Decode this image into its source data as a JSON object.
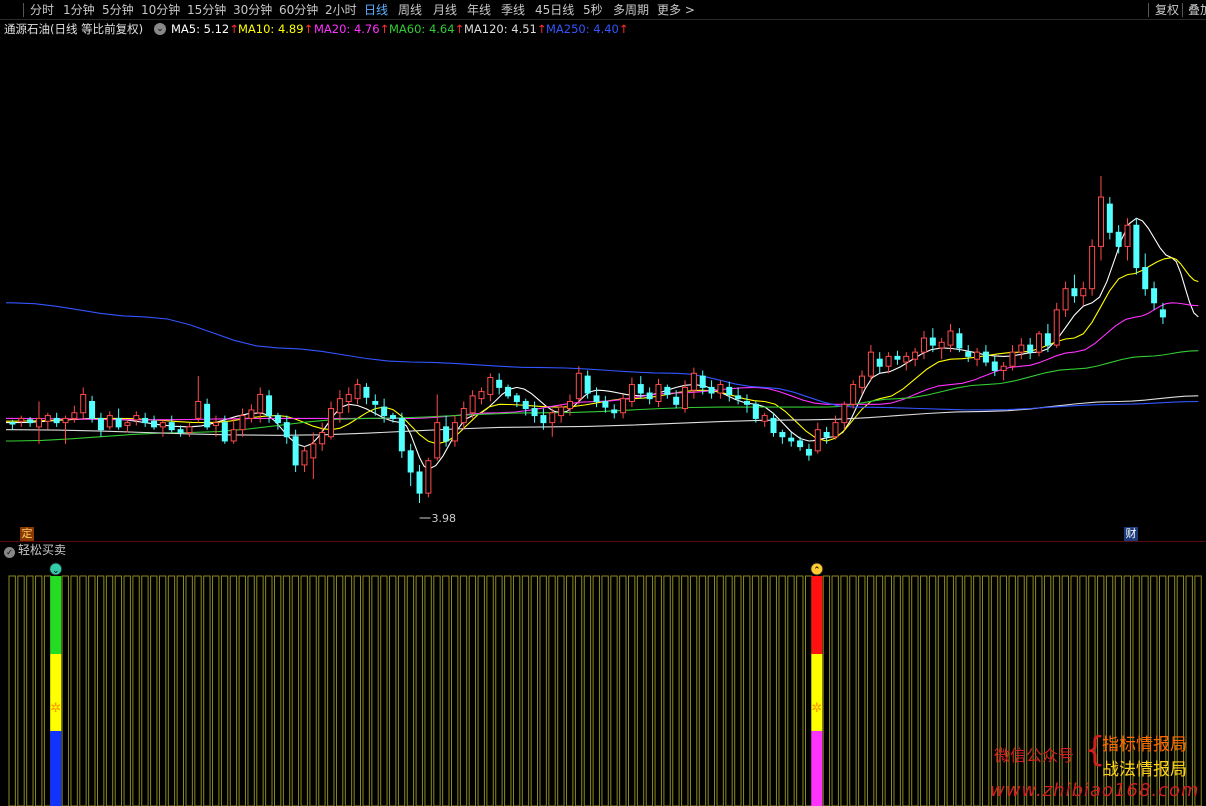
{
  "toolbar": {
    "timeframes": [
      "分时",
      "1分钟",
      "5分钟",
      "10分钟",
      "15分钟",
      "30分钟",
      "60分钟",
      "2小时",
      "日线",
      "周线",
      "月线",
      "年线",
      "季线",
      "45日线",
      "5秒",
      "多周期",
      "更多 >"
    ],
    "active": "日线",
    "right": [
      "复权",
      "叠加"
    ]
  },
  "legend": {
    "title": "通源石油(日线 等比前复权)",
    "ma": [
      {
        "label": "MA5: 5.12",
        "color": "#ffffff"
      },
      {
        "label": "MA10: 4.89",
        "color": "#ffff00"
      },
      {
        "label": "MA20: 4.76",
        "color": "#ff33ff"
      },
      {
        "label": "MA60: 4.64",
        "color": "#33cc33"
      },
      {
        "label": "MA120: 4.51",
        "color": "#dddddd"
      },
      {
        "label": "MA250: 4.40",
        "color": "#3355ff"
      }
    ],
    "arrow": "↑"
  },
  "chart_data": {
    "type": "candlestick",
    "ylim": [
      3.8,
      6.8
    ],
    "candles": [
      [
        4.55,
        4.57,
        4.5,
        4.54
      ],
      [
        4.56,
        4.6,
        4.52,
        4.58
      ],
      [
        4.57,
        4.59,
        4.52,
        4.55
      ],
      [
        4.52,
        4.7,
        4.4,
        4.58
      ],
      [
        4.56,
        4.62,
        4.5,
        4.6
      ],
      [
        4.58,
        4.62,
        4.52,
        4.55
      ],
      [
        4.55,
        4.6,
        4.4,
        4.58
      ],
      [
        4.58,
        4.67,
        4.55,
        4.62
      ],
      [
        4.62,
        4.8,
        4.58,
        4.75
      ],
      [
        4.7,
        4.74,
        4.55,
        4.58
      ],
      [
        4.58,
        4.62,
        4.45,
        4.5
      ],
      [
        4.52,
        4.63,
        4.5,
        4.6
      ],
      [
        4.58,
        4.65,
        4.5,
        4.52
      ],
      [
        4.53,
        4.57,
        4.48,
        4.55
      ],
      [
        4.57,
        4.63,
        4.53,
        4.6
      ],
      [
        4.58,
        4.62,
        4.52,
        4.55
      ],
      [
        4.56,
        4.6,
        4.5,
        4.52
      ],
      [
        4.52,
        4.57,
        4.45,
        4.55
      ],
      [
        4.55,
        4.6,
        4.48,
        4.5
      ],
      [
        4.5,
        4.53,
        4.45,
        4.48
      ],
      [
        4.48,
        4.55,
        4.45,
        4.52
      ],
      [
        4.58,
        4.88,
        4.55,
        4.7
      ],
      [
        4.68,
        4.72,
        4.5,
        4.52
      ],
      [
        4.53,
        4.6,
        4.45,
        4.55
      ],
      [
        4.55,
        4.6,
        4.4,
        4.42
      ],
      [
        4.42,
        4.58,
        4.4,
        4.5
      ],
      [
        4.5,
        4.65,
        4.45,
        4.6
      ],
      [
        4.58,
        4.68,
        4.55,
        4.64
      ],
      [
        4.62,
        4.8,
        4.55,
        4.75
      ],
      [
        4.74,
        4.78,
        4.55,
        4.6
      ],
      [
        4.6,
        4.62,
        4.5,
        4.55
      ],
      [
        4.55,
        4.6,
        4.4,
        4.45
      ],
      [
        4.45,
        4.5,
        4.2,
        4.25
      ],
      [
        4.25,
        4.38,
        4.2,
        4.35
      ],
      [
        4.3,
        4.48,
        4.15,
        4.4
      ],
      [
        4.4,
        4.55,
        4.35,
        4.48
      ],
      [
        4.45,
        4.7,
        4.43,
        4.65
      ],
      [
        4.62,
        4.78,
        4.55,
        4.72
      ],
      [
        4.7,
        4.8,
        4.62,
        4.75
      ],
      [
        4.72,
        4.86,
        4.68,
        4.82
      ],
      [
        4.8,
        4.83,
        4.68,
        4.73
      ],
      [
        4.7,
        4.75,
        4.6,
        4.68
      ],
      [
        4.66,
        4.72,
        4.55,
        4.6
      ],
      [
        4.6,
        4.62,
        4.55,
        4.58
      ],
      [
        4.58,
        4.62,
        4.3,
        4.35
      ],
      [
        4.35,
        4.4,
        4.1,
        4.2
      ],
      [
        4.2,
        4.25,
        3.98,
        4.05
      ],
      [
        4.05,
        4.3,
        4.02,
        4.28
      ],
      [
        4.3,
        4.75,
        4.28,
        4.55
      ],
      [
        4.52,
        4.6,
        4.38,
        4.42
      ],
      [
        4.42,
        4.6,
        4.38,
        4.55
      ],
      [
        4.55,
        4.7,
        4.5,
        4.65
      ],
      [
        4.62,
        4.78,
        4.58,
        4.74
      ],
      [
        4.72,
        4.8,
        4.68,
        4.77
      ],
      [
        4.75,
        4.9,
        4.7,
        4.87
      ],
      [
        4.85,
        4.9,
        4.75,
        4.8
      ],
      [
        4.8,
        4.82,
        4.72,
        4.74
      ],
      [
        4.74,
        4.76,
        4.66,
        4.7
      ],
      [
        4.7,
        4.72,
        4.6,
        4.65
      ],
      [
        4.65,
        4.7,
        4.55,
        4.6
      ],
      [
        4.6,
        4.65,
        4.5,
        4.55
      ],
      [
        4.55,
        4.65,
        4.45,
        4.62
      ],
      [
        4.6,
        4.68,
        4.55,
        4.66
      ],
      [
        4.65,
        4.75,
        4.6,
        4.7
      ],
      [
        4.72,
        4.95,
        4.68,
        4.9
      ],
      [
        4.88,
        4.92,
        4.72,
        4.76
      ],
      [
        4.74,
        4.8,
        4.66,
        4.7
      ],
      [
        4.7,
        4.74,
        4.62,
        4.66
      ],
      [
        4.64,
        4.68,
        4.58,
        4.62
      ],
      [
        4.62,
        4.75,
        4.58,
        4.72
      ],
      [
        4.7,
        4.87,
        4.66,
        4.82
      ],
      [
        4.82,
        4.88,
        4.72,
        4.76
      ],
      [
        4.76,
        4.8,
        4.68,
        4.72
      ],
      [
        4.7,
        4.86,
        4.66,
        4.82
      ],
      [
        4.8,
        4.82,
        4.72,
        4.75
      ],
      [
        4.73,
        4.78,
        4.65,
        4.68
      ],
      [
        4.65,
        4.85,
        4.62,
        4.8
      ],
      [
        4.78,
        4.94,
        4.72,
        4.9
      ],
      [
        4.88,
        4.92,
        4.75,
        4.8
      ],
      [
        4.8,
        4.85,
        4.72,
        4.76
      ],
      [
        4.76,
        4.85,
        4.72,
        4.82
      ],
      [
        4.8,
        4.84,
        4.7,
        4.75
      ],
      [
        4.74,
        4.8,
        4.68,
        4.72
      ],
      [
        4.7,
        4.75,
        4.62,
        4.68
      ],
      [
        4.68,
        4.7,
        4.55,
        4.58
      ],
      [
        4.56,
        4.62,
        4.52,
        4.6
      ],
      [
        4.58,
        4.62,
        4.45,
        4.48
      ],
      [
        4.48,
        4.5,
        4.4,
        4.45
      ],
      [
        4.44,
        4.48,
        4.38,
        4.42
      ],
      [
        4.42,
        4.45,
        4.35,
        4.38
      ],
      [
        4.36,
        4.4,
        4.28,
        4.32
      ],
      [
        4.35,
        4.55,
        4.33,
        4.5
      ],
      [
        4.48,
        4.52,
        4.4,
        4.45
      ],
      [
        4.45,
        4.6,
        4.43,
        4.55
      ],
      [
        4.55,
        4.7,
        4.5,
        4.68
      ],
      [
        4.68,
        4.85,
        4.65,
        4.82
      ],
      [
        4.8,
        4.92,
        4.75,
        4.88
      ],
      [
        4.88,
        5.1,
        4.85,
        5.05
      ],
      [
        5.0,
        5.05,
        4.9,
        4.95
      ],
      [
        4.95,
        5.05,
        4.9,
        5.02
      ],
      [
        5.02,
        5.06,
        4.96,
        5.0
      ],
      [
        4.98,
        5.05,
        4.92,
        5.02
      ],
      [
        5.0,
        5.08,
        4.95,
        5.05
      ],
      [
        5.05,
        5.2,
        5.0,
        5.15
      ],
      [
        5.15,
        5.22,
        5.05,
        5.1
      ],
      [
        5.08,
        5.15,
        5.0,
        5.12
      ],
      [
        5.1,
        5.25,
        5.05,
        5.2
      ],
      [
        5.18,
        5.22,
        5.05,
        5.08
      ],
      [
        5.05,
        5.1,
        4.98,
        5.02
      ],
      [
        5.0,
        5.08,
        4.95,
        5.05
      ],
      [
        5.05,
        5.1,
        4.95,
        4.98
      ],
      [
        4.98,
        5.02,
        4.88,
        4.92
      ],
      [
        4.92,
        4.98,
        4.85,
        4.95
      ],
      [
        4.95,
        5.1,
        4.92,
        5.05
      ],
      [
        5.05,
        5.15,
        5.0,
        5.1
      ],
      [
        5.1,
        5.15,
        5.0,
        5.05
      ],
      [
        5.05,
        5.2,
        5.02,
        5.18
      ],
      [
        5.18,
        5.25,
        5.05,
        5.1
      ],
      [
        5.1,
        5.4,
        5.08,
        5.35
      ],
      [
        5.35,
        5.55,
        5.3,
        5.5
      ],
      [
        5.5,
        5.6,
        5.4,
        5.45
      ],
      [
        5.45,
        5.55,
        5.38,
        5.5
      ],
      [
        5.5,
        5.85,
        5.45,
        5.8
      ],
      [
        5.8,
        6.3,
        5.7,
        6.15
      ],
      [
        6.1,
        6.15,
        5.85,
        5.9
      ],
      [
        5.9,
        5.95,
        5.75,
        5.8
      ],
      [
        5.8,
        6.0,
        5.7,
        5.95
      ],
      [
        5.95,
        6.0,
        5.6,
        5.65
      ],
      [
        5.65,
        5.75,
        5.45,
        5.5
      ],
      [
        5.5,
        5.55,
        5.35,
        5.4
      ],
      [
        5.35,
        5.4,
        5.25,
        5.3
      ]
    ],
    "ma": {
      "MA5": {
        "color": "#ffffff",
        "anchors": [
          [
            0,
            4.55
          ],
          [
            10,
            4.58
          ],
          [
            20,
            4.52
          ],
          [
            28,
            4.62
          ],
          [
            33,
            4.38
          ],
          [
            38,
            4.68
          ],
          [
            44,
            4.55
          ],
          [
            47,
            4.22
          ],
          [
            52,
            4.6
          ],
          [
            57,
            4.8
          ],
          [
            62,
            4.62
          ],
          [
            66,
            4.78
          ],
          [
            71,
            4.74
          ],
          [
            77,
            4.82
          ],
          [
            84,
            4.68
          ],
          [
            90,
            4.42
          ],
          [
            93,
            4.45
          ],
          [
            98,
            4.9
          ],
          [
            105,
            5.08
          ],
          [
            112,
            5.02
          ],
          [
            116,
            5.05
          ],
          [
            122,
            5.4
          ],
          [
            127,
            6.0
          ],
          [
            131,
            5.72
          ],
          [
            134,
            5.3
          ]
        ]
      },
      "MA10": {
        "color": "#ffff00",
        "anchors": [
          [
            0,
            4.56
          ],
          [
            12,
            4.58
          ],
          [
            22,
            4.55
          ],
          [
            30,
            4.6
          ],
          [
            36,
            4.5
          ],
          [
            42,
            4.66
          ],
          [
            48,
            4.4
          ],
          [
            55,
            4.68
          ],
          [
            62,
            4.66
          ],
          [
            70,
            4.72
          ],
          [
            78,
            4.78
          ],
          [
            85,
            4.7
          ],
          [
            92,
            4.42
          ],
          [
            98,
            4.72
          ],
          [
            106,
            5.0
          ],
          [
            114,
            5.05
          ],
          [
            120,
            5.15
          ],
          [
            126,
            5.6
          ],
          [
            131,
            5.72
          ],
          [
            134,
            5.55
          ]
        ]
      },
      "MA20": {
        "color": "#ff33ff",
        "anchors": [
          [
            0,
            4.58
          ],
          [
            15,
            4.57
          ],
          [
            30,
            4.58
          ],
          [
            45,
            4.58
          ],
          [
            55,
            4.62
          ],
          [
            66,
            4.7
          ],
          [
            75,
            4.76
          ],
          [
            84,
            4.8
          ],
          [
            92,
            4.68
          ],
          [
            98,
            4.68
          ],
          [
            106,
            4.82
          ],
          [
            114,
            4.95
          ],
          [
            120,
            5.05
          ],
          [
            127,
            5.3
          ],
          [
            131,
            5.4
          ],
          [
            134,
            5.38
          ]
        ]
      },
      "MA60": {
        "color": "#33cc33",
        "anchors": [
          [
            0,
            4.42
          ],
          [
            20,
            4.48
          ],
          [
            40,
            4.58
          ],
          [
            60,
            4.62
          ],
          [
            80,
            4.66
          ],
          [
            92,
            4.66
          ],
          [
            100,
            4.72
          ],
          [
            110,
            4.82
          ],
          [
            120,
            4.93
          ],
          [
            128,
            5.02
          ],
          [
            134,
            5.06
          ]
        ]
      },
      "MA120": {
        "color": "#dddddd",
        "anchors": [
          [
            0,
            4.5
          ],
          [
            30,
            4.46
          ],
          [
            60,
            4.52
          ],
          [
            90,
            4.57
          ],
          [
            110,
            4.63
          ],
          [
            125,
            4.7
          ],
          [
            134,
            4.74
          ]
        ]
      },
      "MA250": {
        "color": "#3355ff",
        "anchors": [
          [
            0,
            5.4
          ],
          [
            15,
            5.3
          ],
          [
            30,
            5.08
          ],
          [
            45,
            4.98
          ],
          [
            60,
            4.94
          ],
          [
            75,
            4.9
          ],
          [
            85,
            4.8
          ],
          [
            95,
            4.66
          ],
          [
            110,
            4.64
          ],
          [
            125,
            4.68
          ],
          [
            134,
            4.7
          ]
        ]
      }
    },
    "low_label": "3.98",
    "low_index": 46
  },
  "tags": {
    "ding": "定",
    "cai": "财"
  },
  "indicator": {
    "title": "轻松买卖",
    "bar_count": 135,
    "buy_index": 5,
    "sell_index": 91
  },
  "watermark": {
    "wechat": "微信公众号",
    "line1": "指标情报局",
    "line2": "战法情报局",
    "url": "www.zhibiao168.com"
  }
}
